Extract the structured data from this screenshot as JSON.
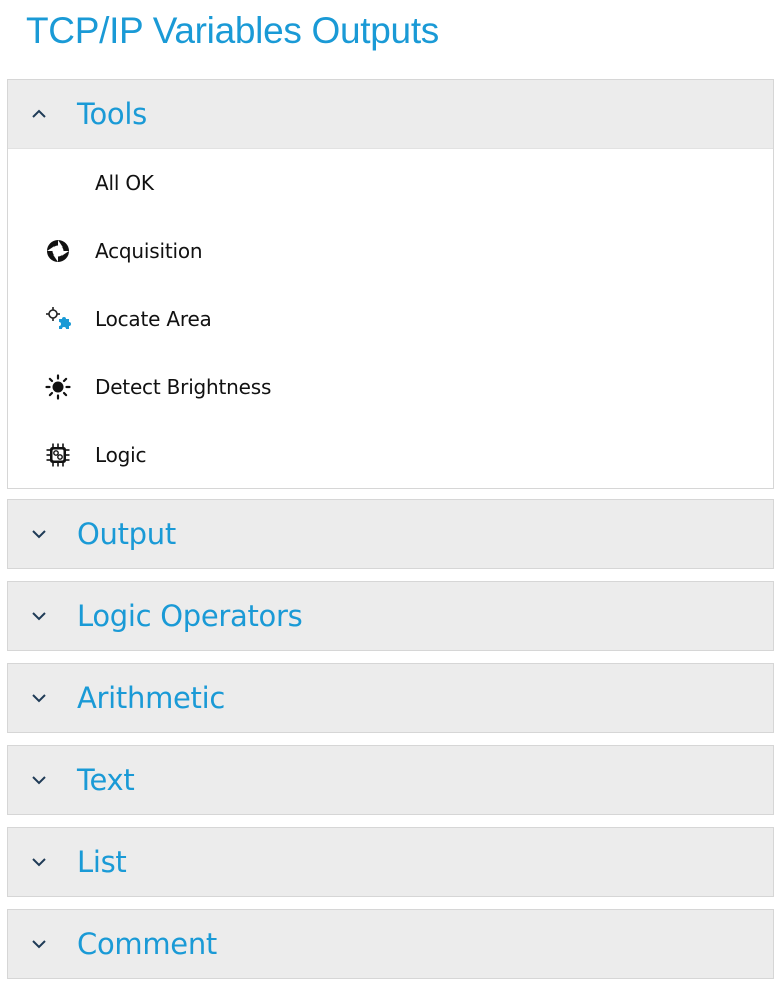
{
  "page": {
    "title": "TCP/IP Variables Outputs",
    "accent_color": "#1a9ad6",
    "header_bg": "#ececec"
  },
  "sections": [
    {
      "label": "Tools",
      "state": "expanded",
      "chevron_icon": "chevron-up-icon",
      "items": [
        {
          "label": "All OK",
          "icon": "none"
        },
        {
          "label": "Acquisition",
          "icon": "aperture-icon"
        },
        {
          "label": "Locate Area",
          "icon": "crosshair-puzzle-icon"
        },
        {
          "label": "Detect Brightness",
          "icon": "sun-icon"
        },
        {
          "label": "Logic",
          "icon": "chip-icon"
        }
      ]
    },
    {
      "label": "Output",
      "state": "collapsed",
      "chevron_icon": "chevron-down-icon"
    },
    {
      "label": "Logic Operators",
      "state": "collapsed",
      "chevron_icon": "chevron-down-icon"
    },
    {
      "label": "Arithmetic",
      "state": "collapsed",
      "chevron_icon": "chevron-down-icon"
    },
    {
      "label": "Text",
      "state": "collapsed",
      "chevron_icon": "chevron-down-icon"
    },
    {
      "label": "List",
      "state": "collapsed",
      "chevron_icon": "chevron-down-icon"
    },
    {
      "label": "Comment",
      "state": "collapsed",
      "chevron_icon": "chevron-down-icon"
    }
  ]
}
